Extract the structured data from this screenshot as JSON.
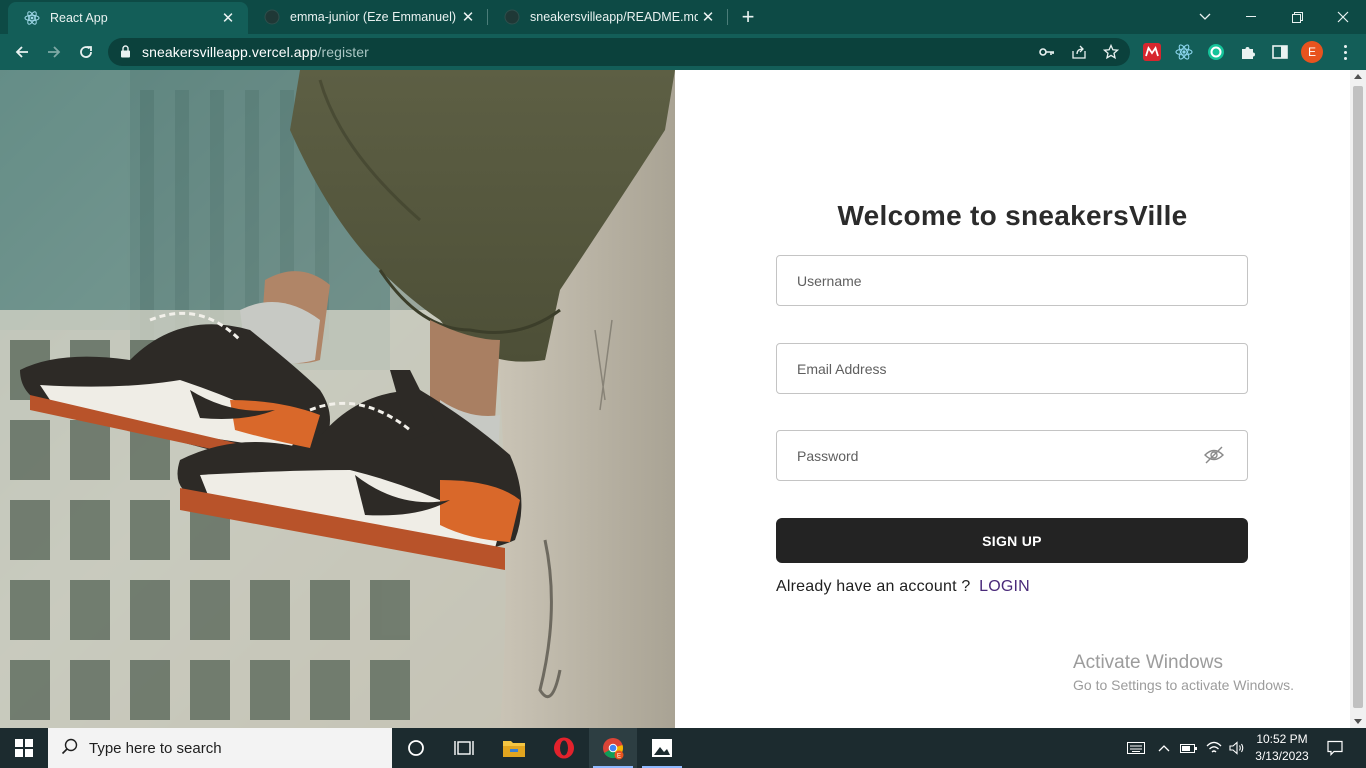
{
  "browser": {
    "tabs": [
      {
        "title": "React App",
        "active": true
      },
      {
        "title": "emma-junior (Eze Emmanuel)",
        "active": false
      },
      {
        "title": "sneakersvilleapp/README.md at",
        "active": false
      }
    ],
    "url_host": "sneakersvilleapp.vercel.app",
    "url_path": "/register",
    "profile_initial": "E"
  },
  "page": {
    "heading": "Welcome to sneakersVille",
    "username_placeholder": "Username",
    "email_placeholder": "Email Address",
    "password_placeholder": "Password",
    "signup_label": "SIGN UP",
    "already_text": "Already have an account ?",
    "login_label": "LOGIN",
    "hero_accent": "#d9682a"
  },
  "watermark": {
    "line1": "Activate Windows",
    "line2": "Go to Settings to activate Windows."
  },
  "taskbar": {
    "search_placeholder": "Type here to search",
    "time": "10:52 PM",
    "date": "3/13/2023"
  }
}
